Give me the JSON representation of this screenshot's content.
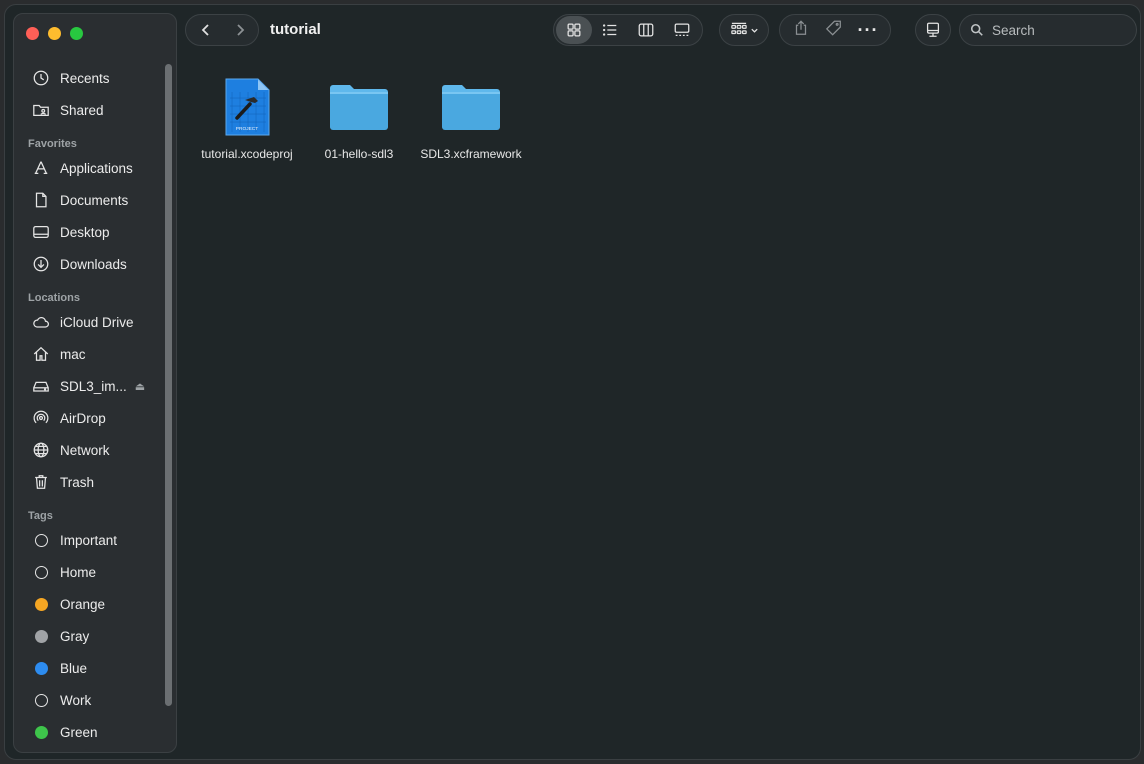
{
  "window": {
    "title": "tutorial"
  },
  "sidebar": {
    "top_items": [
      {
        "label": "Recents",
        "icon": "clock-icon"
      },
      {
        "label": "Shared",
        "icon": "shared-folder-icon"
      }
    ],
    "favorites": {
      "title": "Favorites",
      "items": [
        {
          "label": "Applications",
          "icon": "applications-icon"
        },
        {
          "label": "Documents",
          "icon": "document-icon"
        },
        {
          "label": "Desktop",
          "icon": "desktop-icon"
        },
        {
          "label": "Downloads",
          "icon": "download-icon"
        }
      ]
    },
    "locations": {
      "title": "Locations",
      "items": [
        {
          "label": "iCloud Drive",
          "icon": "cloud-icon"
        },
        {
          "label": "mac",
          "icon": "home-icon"
        },
        {
          "label": "SDL3_im...",
          "icon": "disk-icon",
          "eject": "⏏"
        },
        {
          "label": "AirDrop",
          "icon": "airdrop-icon"
        },
        {
          "label": "Network",
          "icon": "globe-icon"
        },
        {
          "label": "Trash",
          "icon": "trash-icon"
        }
      ]
    },
    "tags": {
      "title": "Tags",
      "items": [
        {
          "label": "Important",
          "color": "none"
        },
        {
          "label": "Home",
          "color": "none"
        },
        {
          "label": "Orange",
          "color": "#f5a623"
        },
        {
          "label": "Gray",
          "color": "#a0a3a6"
        },
        {
          "label": "Blue",
          "color": "#2d8cf0"
        },
        {
          "label": "Work",
          "color": "none"
        },
        {
          "label": "Green",
          "color": "#3ec54b"
        }
      ]
    }
  },
  "toolbar": {
    "search_placeholder": "Search",
    "active_view": "icons"
  },
  "files": [
    {
      "name": "tutorial.xcodeproj",
      "type": "xcodeproj",
      "badge": "PROJECT"
    },
    {
      "name": "01-hello-sdl3",
      "type": "folder"
    },
    {
      "name": "SDL3.xcframework",
      "type": "folder"
    }
  ],
  "colors": {
    "folder": "#4aa8e0",
    "folder_tab": "#5fb8ec",
    "xcodeproj": "#1e7fe0"
  }
}
